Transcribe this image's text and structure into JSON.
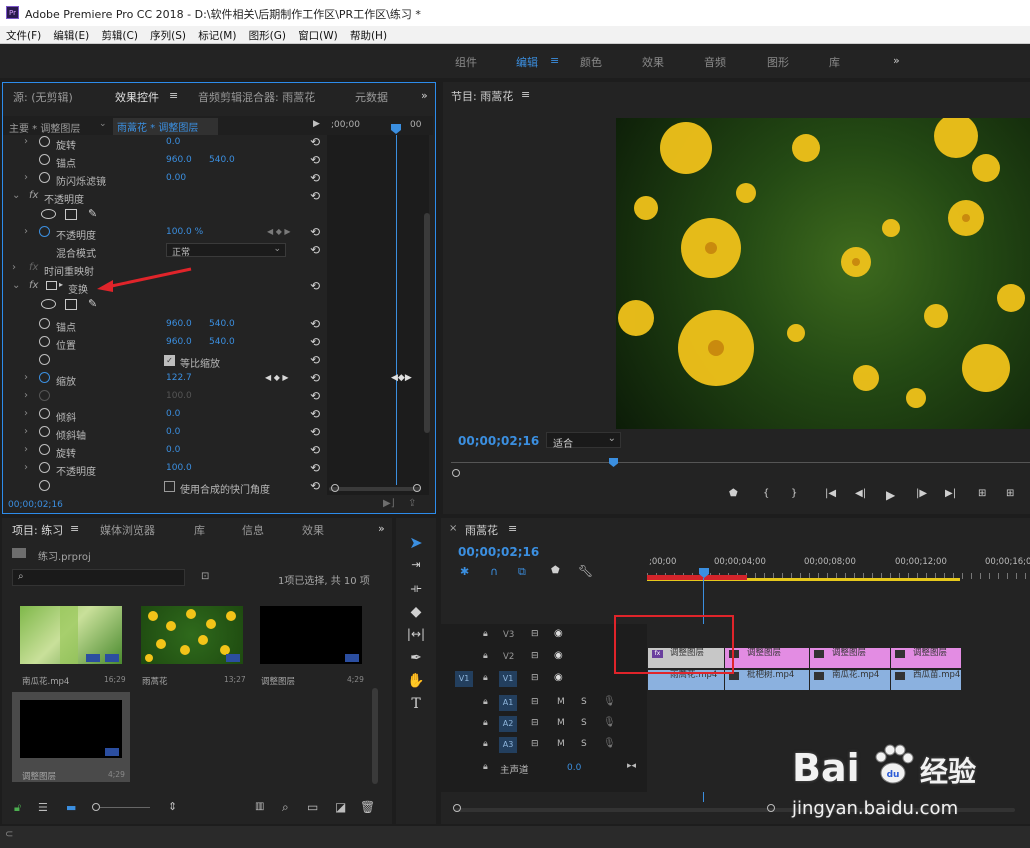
{
  "title_bar": {
    "app_icon": "Pr",
    "title": "Adobe Premiere Pro CC 2018 - D:\\软件相关\\后期制作工作区\\PR工作区\\练习 *"
  },
  "menu": [
    "文件(F)",
    "编辑(E)",
    "剪辑(C)",
    "序列(S)",
    "标记(M)",
    "图形(G)",
    "窗口(W)",
    "帮助(H)"
  ],
  "workspaces": [
    "组件",
    "编辑",
    "颜色",
    "效果",
    "音频",
    "图形",
    "库"
  ],
  "effects_panel": {
    "tabs": [
      "源: (无剪辑)",
      "效果控件",
      "音频剪辑混合器: 雨蒿花",
      "元数据"
    ],
    "header_master": "主要 * 调整图层",
    "header_clip": "雨蒿花 * 调整图层",
    "ruler_start": ";00;00",
    "ruler_end": "00",
    "rows": [
      {
        "label": "旋转",
        "v1": "0.0"
      },
      {
        "label": "锚点",
        "v1": "960.0",
        "v2": "540.0"
      },
      {
        "label": "防闪烁滤镜",
        "v1": "0.00"
      },
      {
        "label": "不透明度"
      },
      {
        "label": "不透明度",
        "v1": "100.0 %"
      },
      {
        "label": "混合模式",
        "v1": "正常"
      },
      {
        "label": "时间重映射"
      },
      {
        "label": "变换"
      },
      {
        "label": "锚点",
        "v1": "960.0",
        "v2": "540.0"
      },
      {
        "label": "位置",
        "v1": "960.0",
        "v2": "540.0"
      },
      {
        "label": "等比缩放"
      },
      {
        "label": "缩放",
        "v1": "122.7"
      },
      {
        "label": "",
        "v1": "100.0"
      },
      {
        "label": "倾斜",
        "v1": "0.0"
      },
      {
        "label": "倾斜轴",
        "v1": "0.0"
      },
      {
        "label": "旋转",
        "v1": "0.0"
      },
      {
        "label": "不透明度",
        "v1": "100.0"
      },
      {
        "label": "使用合成的快门角度"
      }
    ],
    "timecode": "00;00;02;16"
  },
  "program_monitor": {
    "title": "节目: 雨蒿花",
    "timecode": "00;00;02;16",
    "fit": "适合"
  },
  "project_panel": {
    "tabs": [
      "项目: 练习",
      "媒体浏览器",
      "库",
      "信息",
      "效果"
    ],
    "file": "练习.prproj",
    "selection": "1项已选择, 共 10 项",
    "items": [
      {
        "name": "南瓜花.mp4",
        "duration": "16;29"
      },
      {
        "name": "雨蒿花",
        "duration": "13;27"
      },
      {
        "name": "调整图层",
        "duration": "4;29"
      },
      {
        "name": "调整图层",
        "duration": "4;29"
      }
    ]
  },
  "timeline": {
    "tab": "雨蒿花",
    "timecode": "00;00;02;16",
    "ruler": [
      ";00;00",
      "00;00;04;00",
      "00;00;08;00",
      "00;00;12;00",
      "00;00;16;00"
    ],
    "video_tracks": [
      "V3",
      "V2",
      "V1"
    ],
    "audio_tracks": [
      "A1",
      "A2",
      "A3"
    ],
    "source_patch": "V1",
    "master": {
      "label": "主声道",
      "value": "0.0"
    },
    "v2_clips": [
      "调整图层",
      "调整图层",
      "调整图层",
      "调整图层"
    ],
    "v1_clips": [
      "雨蒿花.mp4",
      "枇杷树.mp4",
      "南瓜花.mp4",
      "西瓜苗.mp4"
    ]
  },
  "watermark": {
    "brand": "Bai",
    "brand_cn": "经验",
    "url": "jingyan.baidu.com"
  },
  "colors": {
    "accent": "#3b8fe0",
    "adjust_clip": "#e38ce3",
    "video_clip": "#8bb1df",
    "highlight": "#e0242a"
  }
}
